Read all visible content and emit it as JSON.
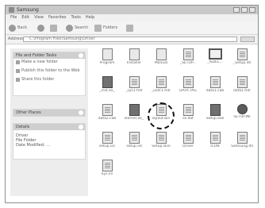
{
  "window": {
    "title": "Samsung"
  },
  "menu": [
    "File",
    "Edit",
    "View",
    "Favorites",
    "Tools",
    "Help"
  ],
  "toolbar": {
    "back": "Back",
    "search": "Search",
    "folders": "Folders"
  },
  "address": {
    "label": "Address",
    "path": "C:\\Program Files\\Samsung\\Driver",
    "go": "Go"
  },
  "taskpane": {
    "file_folder_tasks": {
      "title": "File and Folder Tasks",
      "items": [
        "Make a new folder",
        "Publish this folder to the Web",
        "Share this folder"
      ]
    },
    "other_places": {
      "title": "Other Places"
    },
    "details": {
      "title": "Details",
      "lines": [
        "Driver",
        "File Folder",
        "Date Modified: ..."
      ]
    }
  },
  "files": [
    {
      "name": "Program",
      "icon": "folder-icon"
    },
    {
      "name": "Installer",
      "icon": "folder-icon"
    },
    {
      "name": "Manual",
      "icon": "folder-icon"
    },
    {
      "name": "_SETUP...",
      "icon": "document-icon"
    },
    {
      "name": "_ISDEL...",
      "icon": "window-icon"
    },
    {
      "name": "_Setup.dll",
      "icon": "document-icon"
    },
    {
      "name": "_inst.ex_",
      "icon": "installer-icon"
    },
    {
      "name": "_sys1.hdr",
      "icon": "document-icon"
    },
    {
      "name": "_user1.hdr",
      "icon": "document-icon"
    },
    {
      "name": "DATA.TAG",
      "icon": "document-icon"
    },
    {
      "name": "data1.cab",
      "icon": "cab-icon"
    },
    {
      "name": "data1.hdr",
      "icon": "document-icon"
    },
    {
      "name": "data2.cab",
      "icon": "cab-icon"
    },
    {
      "name": "ikernel.ex_",
      "icon": "installer-icon"
    },
    {
      "name": "layout.bin",
      "icon": "document-icon"
    },
    {
      "name": "os.dat",
      "icon": "document-icon"
    },
    {
      "name": "Setup.exe",
      "icon": "setup-icon",
      "highlighted": true
    },
    {
      "name": "SETUP.INI",
      "icon": "settings-icon"
    },
    {
      "name": "setup.iss",
      "icon": "document-icon"
    },
    {
      "name": "setup.lid",
      "icon": "document-icon"
    },
    {
      "name": "Setup.skin",
      "icon": "document-icon"
    },
    {
      "name": "Driver",
      "icon": "document-icon"
    },
    {
      "name": "ICON",
      "icon": "document-icon"
    },
    {
      "name": "Samsung.dll",
      "icon": "document-icon"
    },
    {
      "name": "Sys.ini",
      "icon": "document-icon"
    }
  ]
}
